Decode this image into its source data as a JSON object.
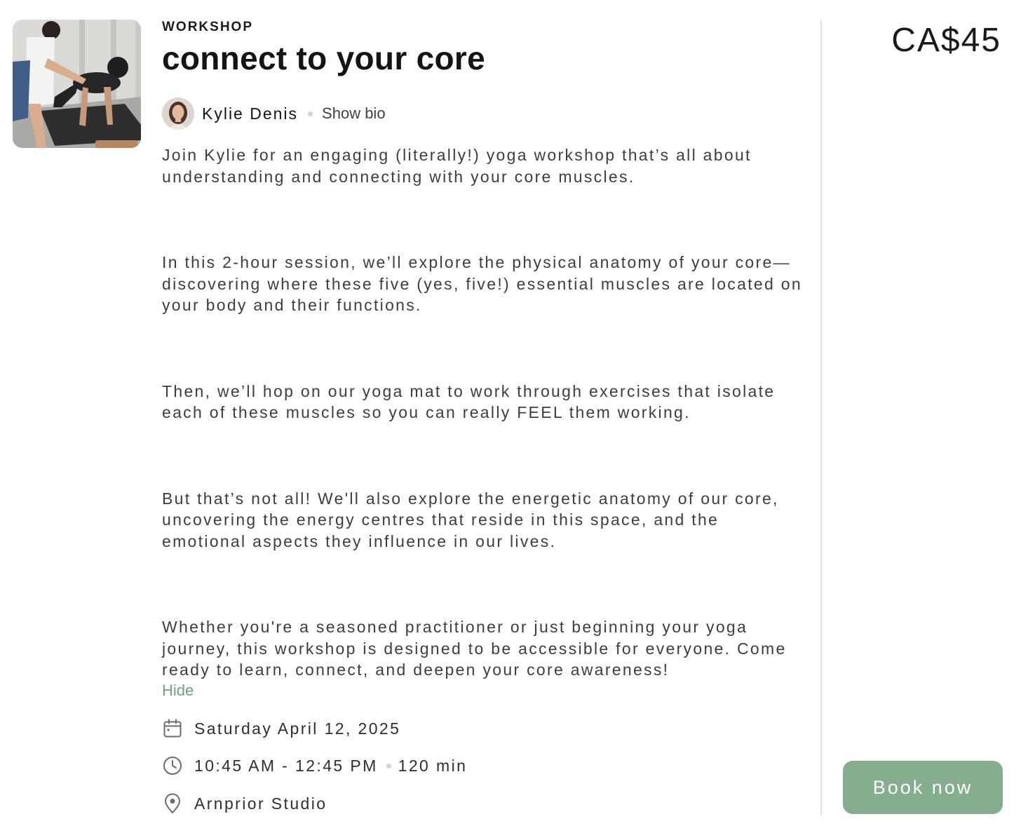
{
  "workshop": {
    "category": "WORKSHOP",
    "title": "connect to your core"
  },
  "instructor": {
    "name": "Kylie Denis",
    "show_bio_label": "Show bio"
  },
  "description": {
    "paragraphs": [
      "Join Kylie for an engaging (literally!) yoga workshop that’s all about understanding and connecting with your core muscles.",
      "In this 2-hour session, we’ll explore the physical anatomy of your core—discovering where these five (yes, five!) essential muscles are located on your body and their functions.",
      "Then, we’ll hop on our yoga mat to work through exercises that isolate each of these muscles so you can really FEEL them working.",
      "But that’s not all! We'll also explore the energetic anatomy of our core, uncovering the energy centres that reside in this space, and the emotional aspects they influence in our lives.",
      "Whether you're a seasoned practitioner or just beginning your yoga journey, this workshop is designed to be accessible for everyone. Come ready to learn, connect, and deepen your core awareness!"
    ],
    "hide_label": "Hide"
  },
  "details": {
    "date": "Saturday April 12, 2025",
    "time": "10:45 AM - 12:45 PM",
    "duration": "120 min",
    "location": "Arnprior Studio",
    "icons": [
      "calendar-icon",
      "clock-icon",
      "location-pin-icon"
    ]
  },
  "pricing": {
    "price": "CA$45",
    "book_label": "Book now"
  },
  "colors": {
    "accent": "#85ae8f",
    "link": "#6ea37c",
    "text": "#2f2f33",
    "divider": "#e3e3e6"
  }
}
